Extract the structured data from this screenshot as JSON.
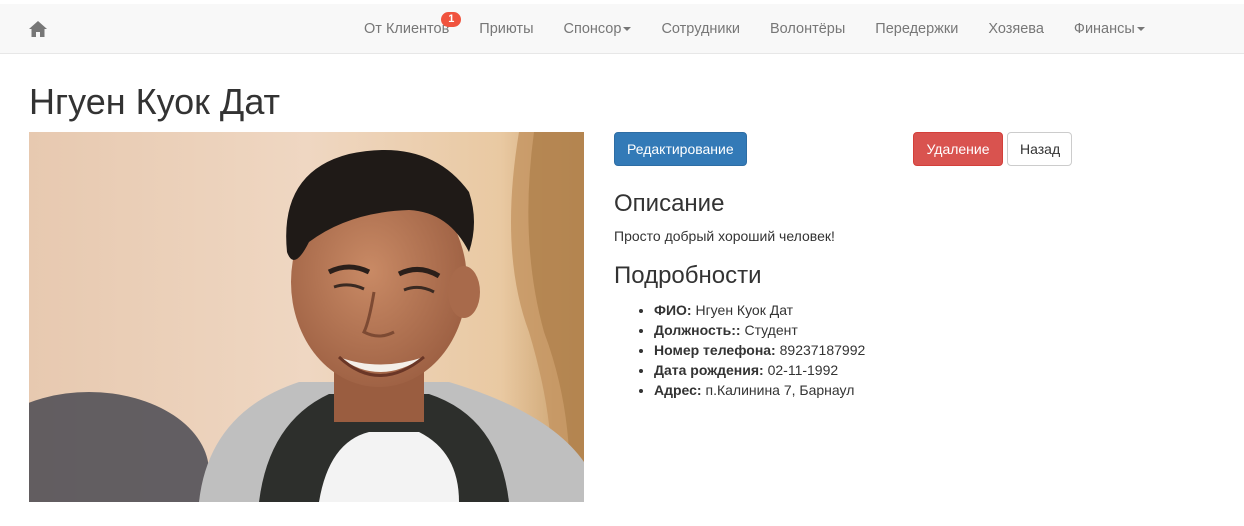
{
  "nav": {
    "items": [
      {
        "label": "От Клиентов",
        "badge": "1",
        "dropdown": false
      },
      {
        "label": "Приюты",
        "dropdown": false
      },
      {
        "label": "Спонсор",
        "dropdown": true
      },
      {
        "label": "Сотрудники",
        "dropdown": false
      },
      {
        "label": "Волонтёры",
        "dropdown": false
      },
      {
        "label": "Передержки",
        "dropdown": false
      },
      {
        "label": "Хозяева",
        "dropdown": false
      },
      {
        "label": "Финансы",
        "dropdown": true
      }
    ]
  },
  "page": {
    "title": "Нгуен Куок Дат"
  },
  "actions": {
    "edit": "Редактирование",
    "delete": "Удаление",
    "back": "Назад"
  },
  "description": {
    "heading": "Описание",
    "text": "Просто добрый хороший человек!"
  },
  "details": {
    "heading": "Подробности",
    "items": [
      {
        "label": "ФИО:",
        "value": "Нгуен Куок Дат"
      },
      {
        "label": "Должность::",
        "value": "Студент"
      },
      {
        "label": "Номер телефона:",
        "value": "89237187992"
      },
      {
        "label": "Дата рождения:",
        "value": "02-11-1992"
      },
      {
        "label": "Адрес:",
        "value": "п.Калинина 7, Барнаул"
      }
    ]
  },
  "colors": {
    "primary": "#337ab7",
    "danger": "#d9534f",
    "badge": "#f0533e"
  },
  "icons": {
    "home": "home-icon",
    "caret": "caret-down-icon"
  }
}
